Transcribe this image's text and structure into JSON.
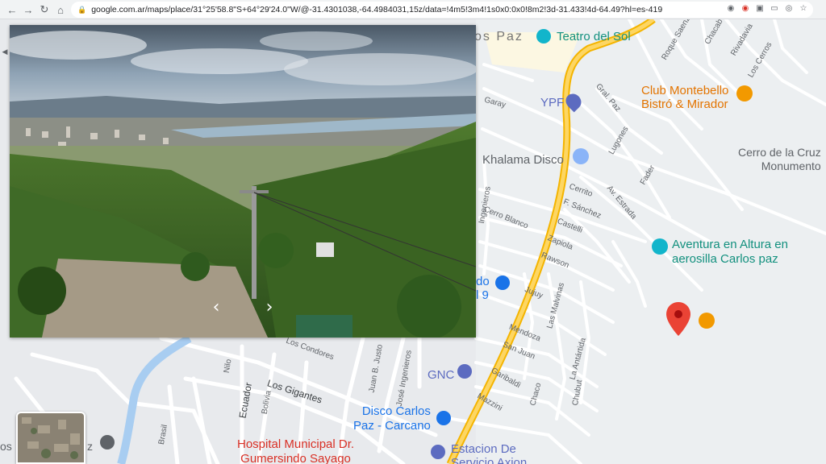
{
  "browser": {
    "url": "google.com.ar/maps/place/31°25'58.8\"S+64°29'24.0\"W/@-31.4301038,-64.4984031,15z/data=!4m5!3m4!1s0x0:0x0!8m2!3d-31.433!4d-64.49?hl=es-419",
    "icons": [
      "back-icon",
      "forward-icon",
      "reload-icon",
      "home-icon",
      "lock-icon"
    ]
  },
  "map": {
    "pois": {
      "teatro": "Teatro del Sol",
      "ypf": "YPF",
      "club_line1": "Club Montebello",
      "club_line2": "Bistró & Mirador",
      "cerro_line1": "Cerro de la Cruz",
      "cerro_line2": "Monumento",
      "khalama": "Khalama Disco",
      "aventura_line1": "Aventura en Altura en",
      "aventura_line2": "aerosilla Carlos paz",
      "market_fragment_1": "do",
      "market_fragment_2": "l 9",
      "gnc": "GNC",
      "disco_line1": "Disco Carlos",
      "disco_line2": "Paz - Carcano",
      "estacion_line1": "Estacion De",
      "estacion_line2": "Servicio Axion",
      "hospital_line1": "Hospital Municipal Dr.",
      "hospital_line2": "Gumersindo Sayago",
      "city_fragment": "os Paz",
      "left_fragment_1": "os",
      "left_fragment_2": "z"
    },
    "streets": {
      "garay": "Garay",
      "gral_paz": "Gral. Paz",
      "lugones": "Lugones",
      "roque_saenz": "Roque Saenz",
      "chacabuco": "Chacab",
      "rivadavia": "Rivadavia",
      "los_cerros": "Los Cerros",
      "fader": "Fader",
      "cerrito": "Cerrito",
      "av_estrada": "Av. Estrada",
      "f_sanchez": "F. Sánchez",
      "ingenieros": "Ingenieros",
      "castelli": "Castelli",
      "cerro_blanco": "Cerro Blanco",
      "zapiola": "Zapiola",
      "rawson": "Rawson",
      "jujuy": "Jujuy",
      "las_malvinas": "Las Malvinas",
      "mendoza": "Mendoza",
      "san_juan": "San Juan",
      "la_antartida": "La Antártida",
      "garibaldi": "Garibaldi",
      "chaco": "Chaco",
      "chubut": "Chubut",
      "mazzini": "Mazzini",
      "los_condores": "Los Condores",
      "juan_b_justo": "Juan B. Justo",
      "jose_ingenieros": "José Ingenieros",
      "los_gigantes": "Los Gigantes",
      "ecuador": "Ecuador",
      "bolivia": "Bolivia",
      "brasil": "Brasil",
      "nilo": "Nilo"
    }
  },
  "colors": {
    "map_bg": "#e8eaed",
    "road": "#ffffff",
    "highway": "#f6c343",
    "river": "#a8cdf1",
    "pin": "#ea4335",
    "poi_blue": "#1a73e8",
    "poi_orange": "#e37400"
  }
}
